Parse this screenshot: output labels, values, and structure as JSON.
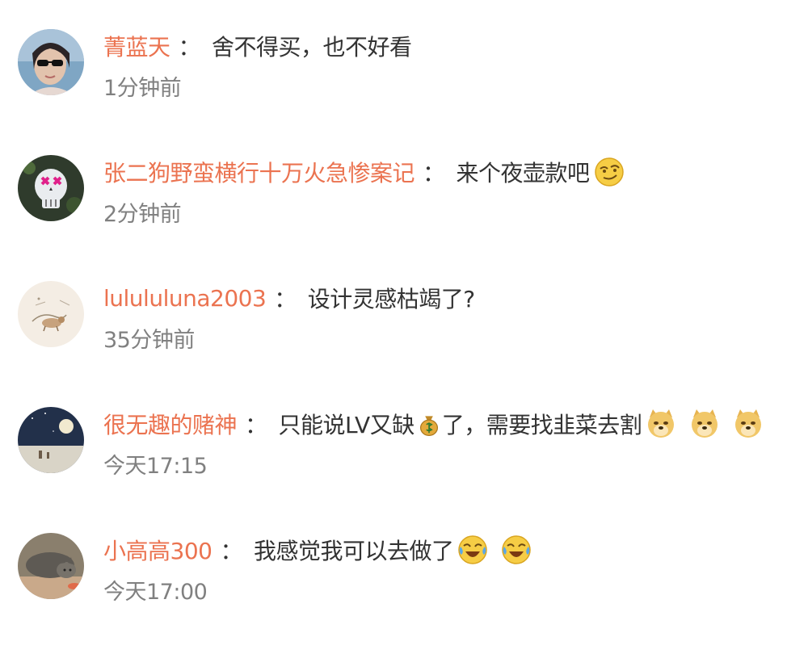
{
  "separator": "：",
  "comments": [
    {
      "username": "菁蓝天",
      "text": "舍不得买，也不好看",
      "time": "1分钟前",
      "avatar": "woman-sunglasses-avatar"
    },
    {
      "username": "张二狗野蛮横行十万火急惨案记",
      "text": "来个夜壶款吧",
      "time": "2分钟前",
      "avatar": "skull-avatar",
      "emoji_after": [
        "smirk-emoji"
      ]
    },
    {
      "username": "lulululuna2003",
      "text": "设计灵感枯竭了?",
      "time": "35分钟前",
      "avatar": "sketch-animal-avatar"
    },
    {
      "username": "很无趣的赌神",
      "text_before_emoji": "只能说LV又缺",
      "inline_emoji": "money-bag-emoji",
      "text_after_emoji": "了，需要找韭菜去割",
      "time": "今天17:15",
      "avatar": "night-moon-avatar",
      "emoji_after": [
        "doge-emoji",
        "doge-emoji",
        "doge-emoji"
      ]
    },
    {
      "username": "小高高300",
      "text": "我感觉我可以去做了",
      "time": "今天17:00",
      "avatar": "cat-avatar",
      "emoji_after": [
        "laugh-cry-emoji",
        "laugh-cry-emoji"
      ]
    }
  ],
  "colors": {
    "username": "#eb7350",
    "text": "#333333",
    "time": "#808080",
    "background": "#ffffff"
  }
}
